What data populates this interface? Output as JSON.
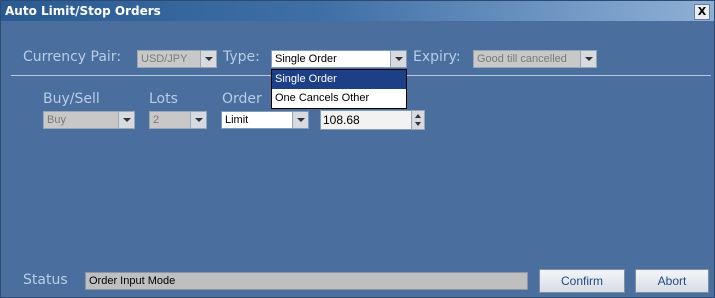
{
  "window": {
    "title": "Auto Limit/Stop Orders",
    "close_label": "X"
  },
  "header": {
    "currency_pair_label": "Currency Pair:",
    "currency_pair_value": "USD/JPY",
    "type_label": "Type:",
    "type_value": "Single Order",
    "expiry_label": "Expiry:",
    "expiry_value": "Good till cancelled",
    "type_options": [
      "Single Order",
      "One Cancels Other"
    ]
  },
  "order": {
    "buy_sell_label": "Buy/Sell",
    "buy_sell_value": "Buy",
    "lots_label": "Lots",
    "lots_value": "2",
    "order_label": "Order",
    "order_type_value": "Limit",
    "price_value": "108.68"
  },
  "footer": {
    "status_label": "Status",
    "status_value": "Order Input Mode",
    "confirm_label": "Confirm",
    "abort_label": "Abort"
  },
  "colors": {
    "background": "#4a6f9e",
    "label_text": "#b8cde6",
    "dropdown_selection": "#1d3f86"
  }
}
